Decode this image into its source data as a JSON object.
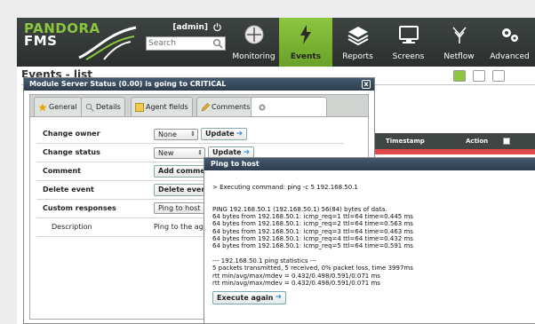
{
  "header": {
    "logo_line1": "PANDORA",
    "logo_line2": "FMS",
    "user": "[admin]",
    "search_placeholder": "Search",
    "nav": [
      {
        "label": "Monitoring",
        "icon": "monitoring-icon"
      },
      {
        "label": "Events",
        "icon": "events-icon",
        "active": true
      },
      {
        "label": "Reports",
        "icon": "reports-icon"
      },
      {
        "label": "Screens",
        "icon": "screens-icon"
      },
      {
        "label": "Netflow",
        "icon": "netflow-icon"
      },
      {
        "label": "Advanced",
        "icon": "advanced-icon"
      }
    ],
    "colors": {
      "active": "#8dc63f",
      "bar": "#3d4441"
    }
  },
  "page": {
    "title": "Events - list"
  },
  "events_table": {
    "columns": [
      "Timestamp",
      "Action"
    ]
  },
  "module_dialog": {
    "title": "Module Server Status (0.00) is going to CRITICAL",
    "close": "x",
    "tabs": [
      {
        "label": "General",
        "icon": "star-icon"
      },
      {
        "label": "Details",
        "icon": "magnifier-icon"
      },
      {
        "label": "Agent fields",
        "icon": "agent-icon"
      },
      {
        "label": "Comments",
        "icon": "pencil-icon"
      },
      {
        "label": "",
        "icon": "gear-icon",
        "active": true
      }
    ],
    "fields": {
      "change_owner": {
        "label": "Change owner",
        "value": "None",
        "button": "Update"
      },
      "change_status": {
        "label": "Change status",
        "value": "New",
        "button": "Update"
      },
      "comment": {
        "label": "Comment",
        "button": "Add comment"
      },
      "delete_event": {
        "label": "Delete event",
        "button": "Delete event"
      },
      "custom_responses": {
        "label": "Custom responses",
        "value": "Ping to host"
      },
      "description": {
        "label": "Description",
        "value": "Ping to the agent"
      }
    }
  },
  "ping_dialog": {
    "title": "Ping to host",
    "output": [
      "> Executing command: ping -c 5 192.168.50.1",
      "",
      "",
      "PING 192.168.50.1 (192.168.50.1) 56(84) bytes of data.",
      "64 bytes from 192.168.50.1: icmp_req=1 ttl=64 time=0.445 ms",
      "64 bytes from 192.168.50.1: icmp_req=2 ttl=64 time=0.563 ms",
      "64 bytes from 192.168.50.1: icmp_req=3 ttl=64 time=0.463 ms",
      "64 bytes from 192.168.50.1: icmp_req=4 ttl=64 time=0.432 ms",
      "64 bytes from 192.168.50.1: icmp_req=5 ttl=64 time=0.591 ms",
      "",
      "--- 192.168.50.1 ping statistics ---",
      "5 packets transmitted, 5 received, 0% packet loss, time 3997ms",
      "rtt min/avg/max/mdev = 0.432/0.498/0.591/0.071 ms",
      "rtt min/avg/max/mdev = 0.432/0.498/0.591/0.071 ms"
    ],
    "button": "Execute again"
  }
}
